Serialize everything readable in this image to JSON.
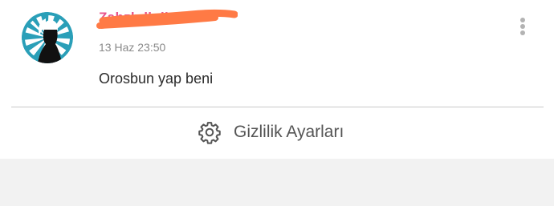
{
  "post": {
    "username": "Zahzhdlolk##",
    "timestamp": "13 Haz 23:50",
    "text": "Orosbun yap beni"
  },
  "footer": {
    "privacy_label": "Gizlilik Ayarları"
  },
  "icons": {
    "menu": "more-vertical-icon",
    "settings": "gear-icon"
  },
  "colors": {
    "username": "#e8558c",
    "redaction": "#ff7a45",
    "avatar_ring": "#2a9fb8"
  }
}
